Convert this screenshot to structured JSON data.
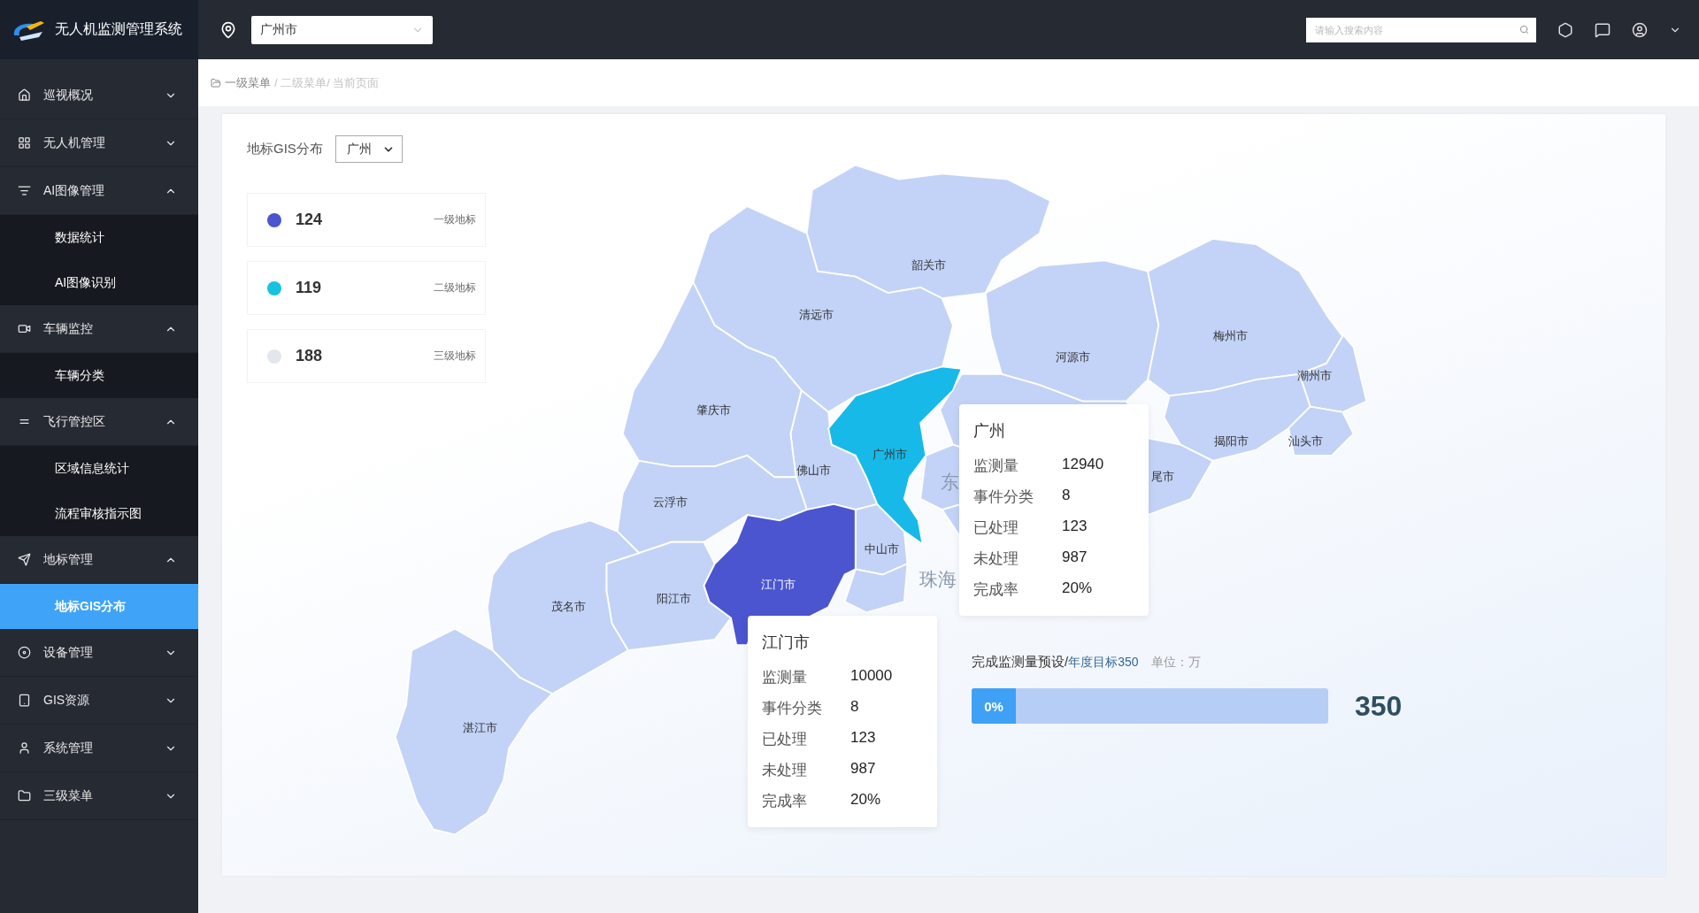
{
  "header": {
    "app_title": "无人机监测管理系统",
    "city_select": "广州市",
    "search": {
      "placeholder": "请输入搜索内容"
    }
  },
  "breadcrumb": [
    {
      "label": "一级菜单",
      "kind": "link"
    },
    {
      "label": "/ 二级菜单/ 当前页面",
      "kind": "trail"
    }
  ],
  "sidebar": {
    "items": [
      {
        "label": "巡视概况",
        "expanded": false
      },
      {
        "label": "无人机管理",
        "expanded": false
      },
      {
        "label": "AI图像管理",
        "expanded": true,
        "children": [
          {
            "label": "数据统计",
            "selected": false
          },
          {
            "label": "AI图像识别",
            "selected": false
          }
        ]
      },
      {
        "label": "车辆监控",
        "expanded": true,
        "children": [
          {
            "label": "车辆分类",
            "selected": false
          }
        ]
      },
      {
        "label": "飞行管控区",
        "expanded": true,
        "children": [
          {
            "label": "区域信息统计",
            "selected": false
          },
          {
            "label": "流程审核指示图",
            "selected": false
          }
        ]
      },
      {
        "label": "地标管理",
        "expanded": true,
        "children": [
          {
            "label": "地标GIS分布",
            "selected": true
          }
        ]
      },
      {
        "label": "设备管理",
        "expanded": false
      },
      {
        "label": "GIS资源",
        "expanded": false
      },
      {
        "label": "系统管理",
        "expanded": false
      },
      {
        "label": "三级菜单",
        "expanded": false
      }
    ]
  },
  "panel": {
    "title": "地标GIS分布",
    "filter": "广州",
    "legend": [
      {
        "value": "124",
        "label": "一级地标",
        "color": "#4a55cf"
      },
      {
        "value": "119",
        "label": "二级地标",
        "color": "#17c3dc"
      },
      {
        "value": "188",
        "label": "三级地标",
        "color": "#e3e6ec"
      }
    ],
    "map": {
      "regions": [
        {
          "label": "韶关市",
          "color": "#c3d3f7",
          "kind": "normal"
        },
        {
          "label": "清远市",
          "color": "#c3d3f7",
          "kind": "normal"
        },
        {
          "label": "河源市",
          "color": "#c3d3f7",
          "kind": "normal"
        },
        {
          "label": "梅州市",
          "color": "#c3d3f7",
          "kind": "normal"
        },
        {
          "label": "潮州市",
          "color": "#c3d3f7",
          "kind": "normal"
        },
        {
          "label": "揭阳市",
          "color": "#c3d3f7",
          "kind": "normal"
        },
        {
          "label": "汕头市",
          "color": "#c3d3f7",
          "kind": "normal"
        },
        {
          "label": "尾市",
          "color": "#c3d3f7",
          "kind": "normal"
        },
        {
          "color": "#c3d3f7",
          "kind": "normal"
        },
        {
          "label": "东",
          "color": "#c3d3f7",
          "kind": "emphasis"
        },
        {
          "color": "#c3d3f7",
          "kind": "normal"
        },
        {
          "label": "佛山市",
          "color": "#c3d3f7",
          "kind": "normal"
        },
        {
          "label": "肇庆市",
          "color": "#c3d3f7",
          "kind": "normal"
        },
        {
          "label": "云浮市",
          "color": "#c3d3f7",
          "kind": "normal"
        },
        {
          "label": "中山市",
          "color": "#c3d3f7",
          "kind": "normal"
        },
        {
          "label": "珠海",
          "color": "#c3d3f7",
          "kind": "emphasis"
        },
        {
          "label": "阳江市",
          "color": "#c3d3f7",
          "kind": "normal"
        },
        {
          "label": "茂名市",
          "color": "#c3d3f7",
          "kind": "normal"
        },
        {
          "label": "湛江市",
          "color": "#c3d3f7",
          "kind": "normal"
        },
        {
          "label": "广州市",
          "color": "#17b9e8",
          "kind": "normal"
        },
        {
          "label": "江门市",
          "color": "#4b55d0",
          "kind": "normal"
        }
      ],
      "tooltips": [
        {
          "title": "广州",
          "rows": [
            {
              "label": "监测量",
              "value": "12940"
            },
            {
              "label": "事件分类",
              "value": "8"
            },
            {
              "label": "已处理",
              "value": "123"
            },
            {
              "label": "未处理",
              "value": "987"
            },
            {
              "label": "完成率",
              "value": "20%"
            }
          ]
        },
        {
          "title": "江门市",
          "rows": [
            {
              "label": "监测量",
              "value": "10000"
            },
            {
              "label": "事件分类",
              "value": "8"
            },
            {
              "label": "已处理",
              "value": "123"
            },
            {
              "label": "未处理",
              "value": "987"
            },
            {
              "label": "完成率",
              "value": "20%"
            }
          ]
        }
      ]
    },
    "progress": {
      "title": "完成监测量预设/",
      "target": "年度目标350",
      "unit": "单位：万",
      "level": 0,
      "percent": "0%",
      "total": "350"
    }
  }
}
